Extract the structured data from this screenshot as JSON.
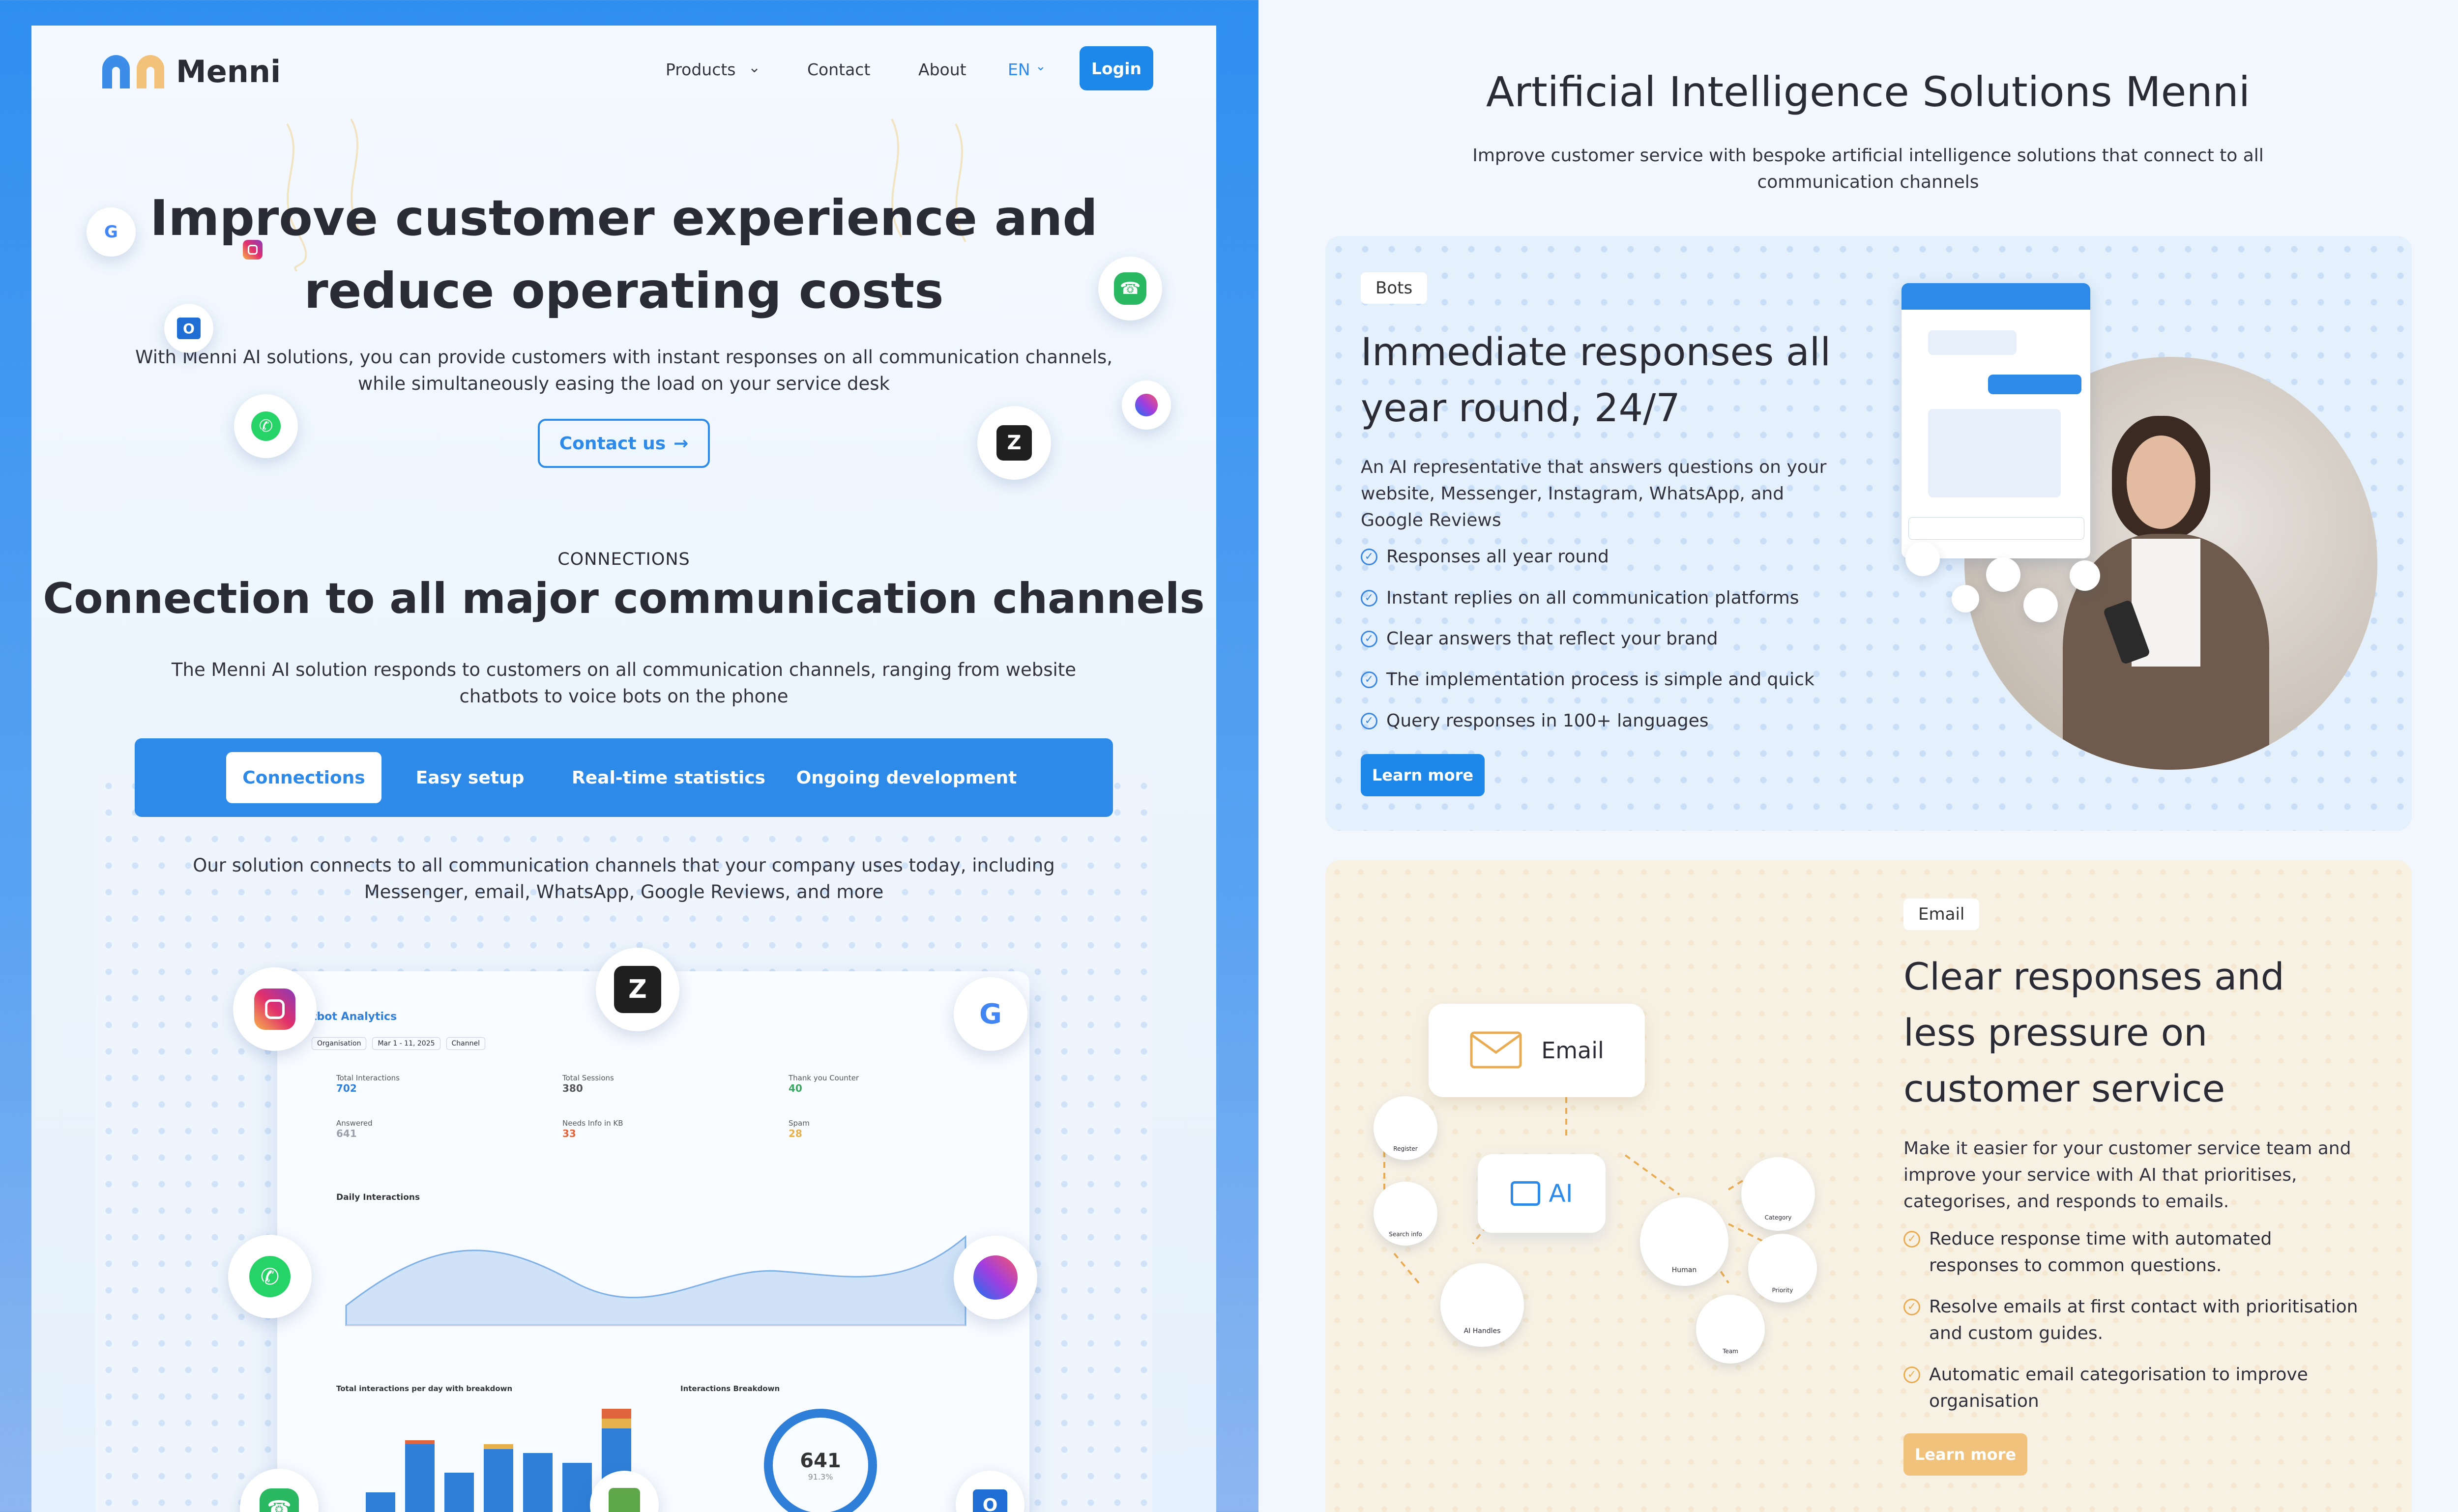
{
  "brand": {
    "name": "Menni"
  },
  "nav": {
    "products": "Products",
    "contact": "Contact",
    "about": "About",
    "language": "EN",
    "login": "Login"
  },
  "hero": {
    "title_line1": "Improve customer experience and",
    "title_line2": "reduce operating costs",
    "subtitle_line1": "With Menni AI solutions, you can provide customers with instant responses on all communication channels,",
    "subtitle_line2": "while simultaneously easing the load on your service desk",
    "cta": "Contact us"
  },
  "connections": {
    "eyebrow": "CONNECTIONS",
    "title": "Connection to all major communication channels",
    "desc_line1": "The Menni AI solution responds to customers on all communication channels, ranging from website",
    "desc_line2": "chatbots to voice bots on the phone",
    "tabs": [
      "Connections",
      "Easy setup",
      "Real-time statistics",
      "Ongoing development"
    ],
    "active_tab": "Connections",
    "tab_desc_line1": "Our solution connects to all communication channels that your company uses today, including",
    "tab_desc_line2": "Messenger, email, WhatsApp, Google Reviews, and more"
  },
  "dashboard": {
    "title": "tbot Analytics",
    "filters": [
      "Organisation",
      "Mar 1 - 11, 2025",
      "Channel"
    ],
    "stats": [
      {
        "label": "Total Interactions",
        "value": "702",
        "color": "#2f7fd8"
      },
      {
        "label": "Total Sessions",
        "value": "380",
        "color": "#555555"
      },
      {
        "label": "Thank you Counter",
        "value": "40",
        "color": "#3aa760"
      },
      {
        "label": "Answered",
        "value": "641",
        "color": "#9aa0aa"
      },
      {
        "label": "Needs Info in KB",
        "value": "33",
        "color": "#e0653c"
      },
      {
        "label": "Spam",
        "value": "28",
        "color": "#e6b04a"
      }
    ],
    "daily_title": "Daily Interactions",
    "breakdown_title": "Total interactions per day with breakdown",
    "donut_title": "Interactions Breakdown",
    "donut_value": "641",
    "donut_pct": "91.3%"
  },
  "right": {
    "title": "Artificial Intelligence Solutions Menni",
    "subtitle_line1": "Improve customer service with bespoke artificial intelligence solutions that connect to all",
    "subtitle_line2": "communication channels",
    "bots": {
      "tag": "Bots",
      "title_line1": "Immediate responses all",
      "title_line2": "year round, 24/7",
      "desc_line1": "An AI representative that answers questions on your",
      "desc_line2": "website, Messenger, Instagram, WhatsApp, and",
      "desc_line3": "Google Reviews",
      "features": [
        "Responses all year round",
        "Instant replies on all communication platforms",
        "Clear answers that reflect your brand",
        "The implementation process is simple and quick",
        "Query responses in 100+ languages"
      ],
      "cta": "Learn more"
    },
    "email": {
      "tag": "Email",
      "title_line1": "Clear responses and",
      "title_line2": "less pressure on",
      "title_line3": "customer service",
      "desc_line1": "Make it easier for your customer service team and",
      "desc_line2": "improve your service with AI that prioritises,",
      "desc_line3": "categorises, and responds to emails.",
      "features": [
        {
          "l1": "Reduce response time with automated",
          "l2": "responses to common questions."
        },
        {
          "l1": "Resolve emails at first contact with prioritisation",
          "l2": "and custom guides."
        },
        {
          "l1": "Automatic email categorisation to improve",
          "l2": "organisation"
        }
      ],
      "cta": "Learn more",
      "diagram": {
        "email_node": "Email",
        "ai_node": "AI",
        "nodes": [
          "Register",
          "Search info",
          "AI Handles",
          "Human",
          "Team",
          "Category",
          "Priority"
        ]
      }
    }
  },
  "colors": {
    "primary": "#2d8ae8",
    "accent_orange": "#f0c27c",
    "dark": "#2b2b36"
  }
}
